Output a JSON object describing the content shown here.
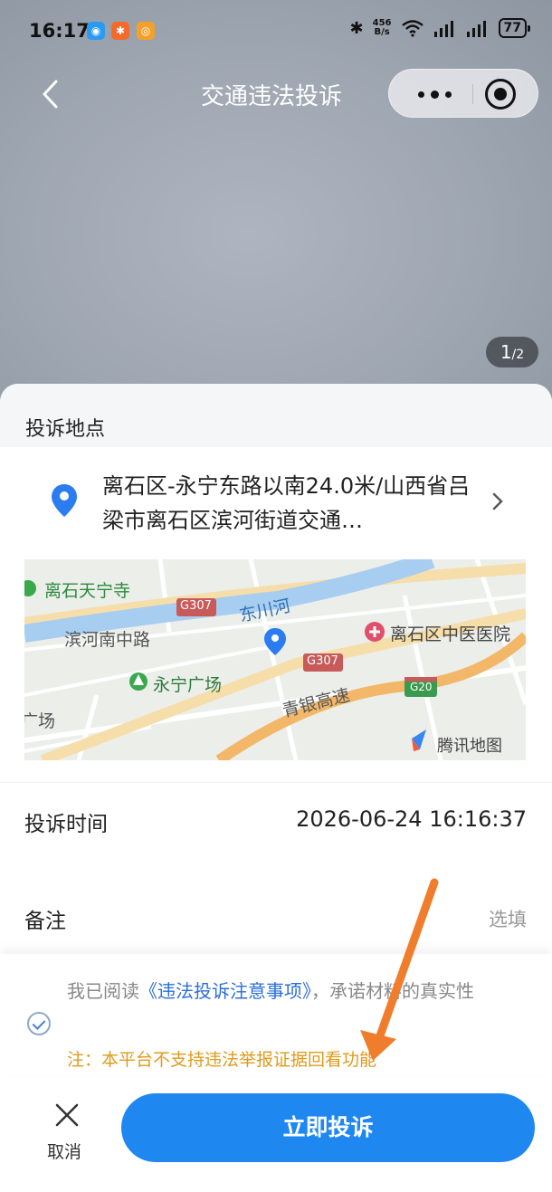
{
  "status_bar": {
    "time": "16:17",
    "net_speed_top": "456",
    "net_speed_bottom": "B/s",
    "battery": "77"
  },
  "nav": {
    "title": "交通违法投诉"
  },
  "photo": {
    "page_current": "1",
    "page_total": "/2"
  },
  "location_section": {
    "title": "投诉地点",
    "address": "离石区-永宁东路以南24.0米/山西省吕梁市离石区滨河街道交通…"
  },
  "map": {
    "labels": {
      "temple": "离石天宁寺",
      "river": "东川河",
      "g307_a": "G307",
      "g307_b": "G307",
      "road1": "滨河南中路",
      "hospital": "离石区中医医院",
      "square": "永宁广场",
      "g20": "G20",
      "expressway": "青银高速",
      "edge": "广场",
      "brand": "腾讯地图"
    }
  },
  "time_row": {
    "label": "投诉时间",
    "value": "2026-06-24 16:16:37"
  },
  "remark_row": {
    "label": "备注",
    "placeholder": "选填"
  },
  "agreement": {
    "prefix": "我已阅读",
    "link": "《违法投诉注意事项》",
    "suffix": "，承诺材料的真实性",
    "note": "注：本平台不支持违法举报证据回看功能"
  },
  "actions": {
    "cancel": "取消",
    "submit": "立即投诉"
  },
  "colors": {
    "primary": "#1e87f0",
    "note": "#e09a1a",
    "arrow": "#f07d2c"
  }
}
